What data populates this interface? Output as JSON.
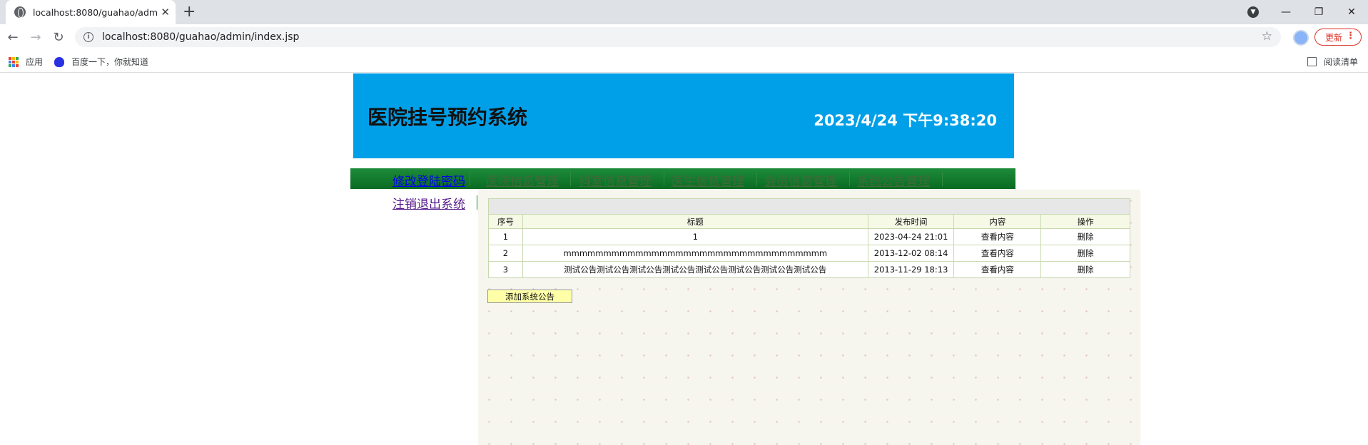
{
  "browser": {
    "tab_title": "localhost:8080/guahao/admin/index.jsp",
    "new_tab_icon": "+",
    "url": "localhost:8080/guahao/admin/index.jsp",
    "update_label": "更新",
    "bookmarks": [
      {
        "label": "应用",
        "icon": "apps-icon"
      },
      {
        "label": "百度一下，你就知道",
        "icon": "baidu-paw-icon"
      }
    ],
    "reading_list_label": "阅读清单"
  },
  "header": {
    "title": "医院挂号预约系统",
    "clock": "2023/4/24 下午9:38:20",
    "background_color": "#00a0e9"
  },
  "menu": {
    "items": [
      {
        "label": "修改登陆密码"
      },
      {
        "label": "医院信息管理"
      },
      {
        "label": "科室信息管理"
      },
      {
        "label": "医生信息管理"
      },
      {
        "label": "会员信息管理"
      },
      {
        "label": "系统公告管理"
      }
    ],
    "logout_label": "注销退出系统"
  },
  "announcements": {
    "columns": [
      "序号",
      "标题",
      "发布时间",
      "内容",
      "操作"
    ],
    "rows": [
      {
        "no": "1",
        "title": "1",
        "time": "2023-04-24 21:01",
        "view": "查看内容",
        "action": "删除"
      },
      {
        "no": "2",
        "title": "mmmmmmmmmmmmmmmmmmmmmmmmmmmmmmmmm",
        "time": "2013-12-02 08:14",
        "view": "查看内容",
        "action": "删除"
      },
      {
        "no": "3",
        "title": "测试公告测试公告测试公告测试公告测试公告测试公告测试公告测试公告",
        "time": "2013-11-29 18:13",
        "view": "查看内容",
        "action": "删除"
      }
    ],
    "add_button_label": "添加系统公告"
  }
}
